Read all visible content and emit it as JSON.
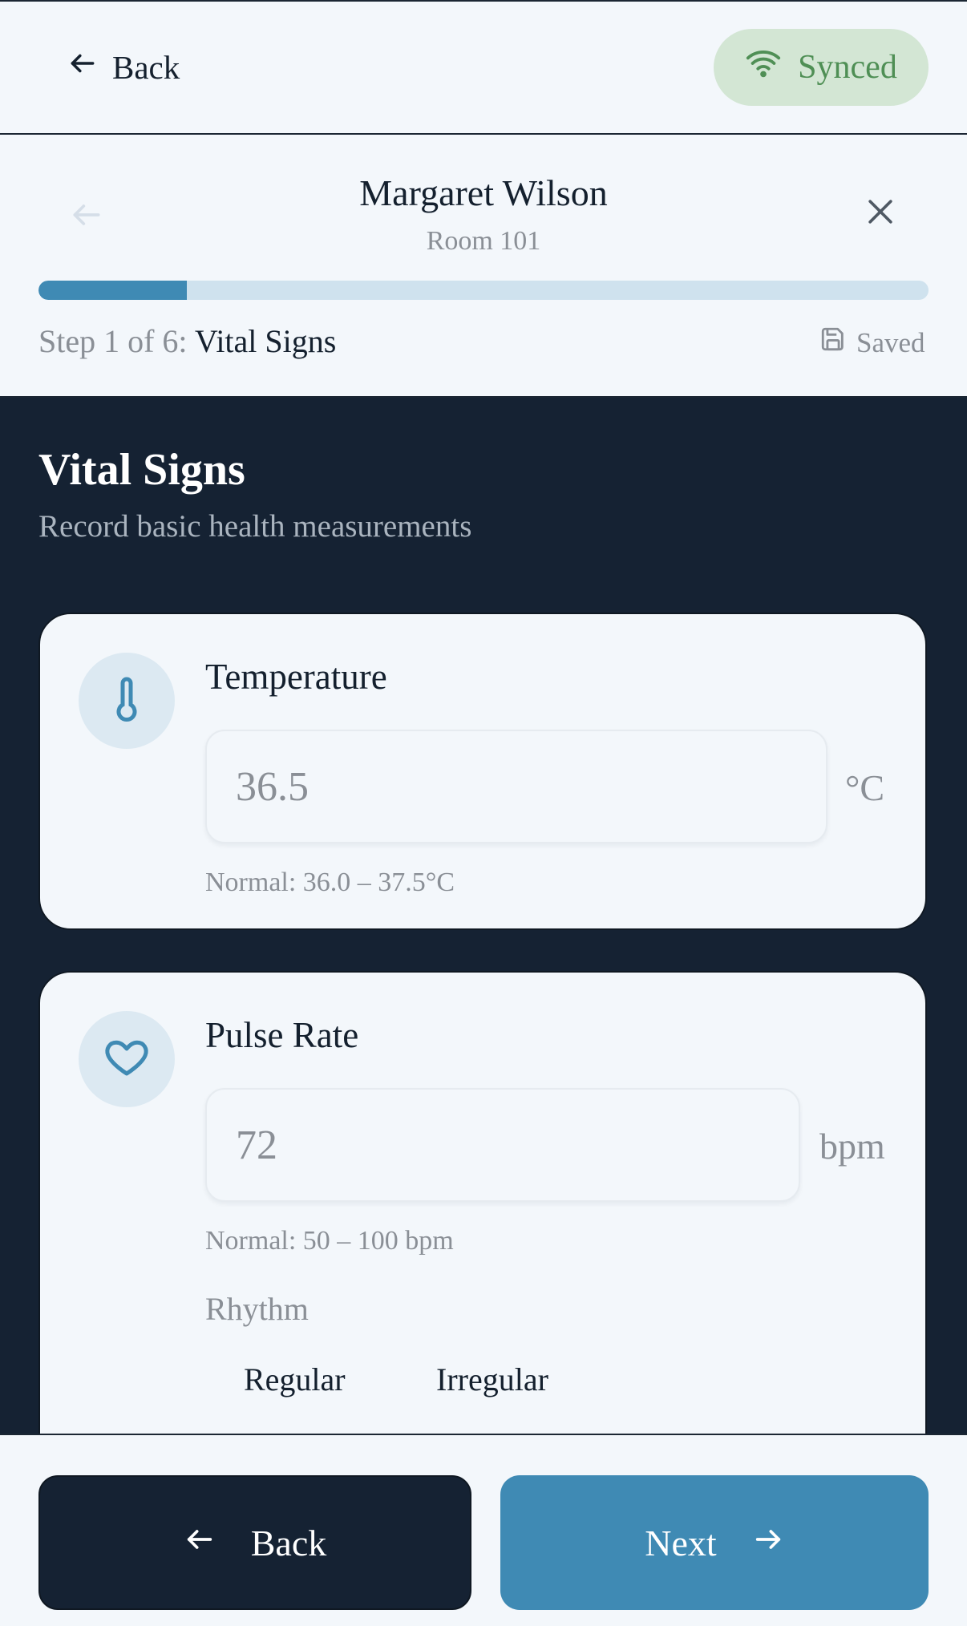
{
  "topbar": {
    "back_label": "Back",
    "sync_label": "Synced"
  },
  "patient": {
    "name": "Margaret Wilson",
    "room": "Room 101"
  },
  "progress": {
    "current_step": 1,
    "total_steps": 6,
    "fraction": 0.1667,
    "step_prefix": "Step 1 of 6:",
    "step_name": "Vital Signs",
    "saved_label": "Saved"
  },
  "section": {
    "title": "Vital Signs",
    "subtitle": "Record basic health measurements"
  },
  "temperature": {
    "label": "Temperature",
    "placeholder": "36.5",
    "unit": "°C",
    "normal": "Normal: 36.0 – 37.5°C"
  },
  "pulse": {
    "label": "Pulse Rate",
    "placeholder": "72",
    "unit": "bpm",
    "normal": "Normal: 50 – 100 bpm",
    "rhythm_label": "Rhythm",
    "rhythm_options": [
      "Regular",
      "Irregular"
    ]
  },
  "footer": {
    "back_label": "Back",
    "next_label": "Next"
  },
  "colors": {
    "accent": "#3f8ab4",
    "dark": "#152233",
    "synced_bg": "#d3e6d4",
    "synced_text": "#4f8f55"
  }
}
